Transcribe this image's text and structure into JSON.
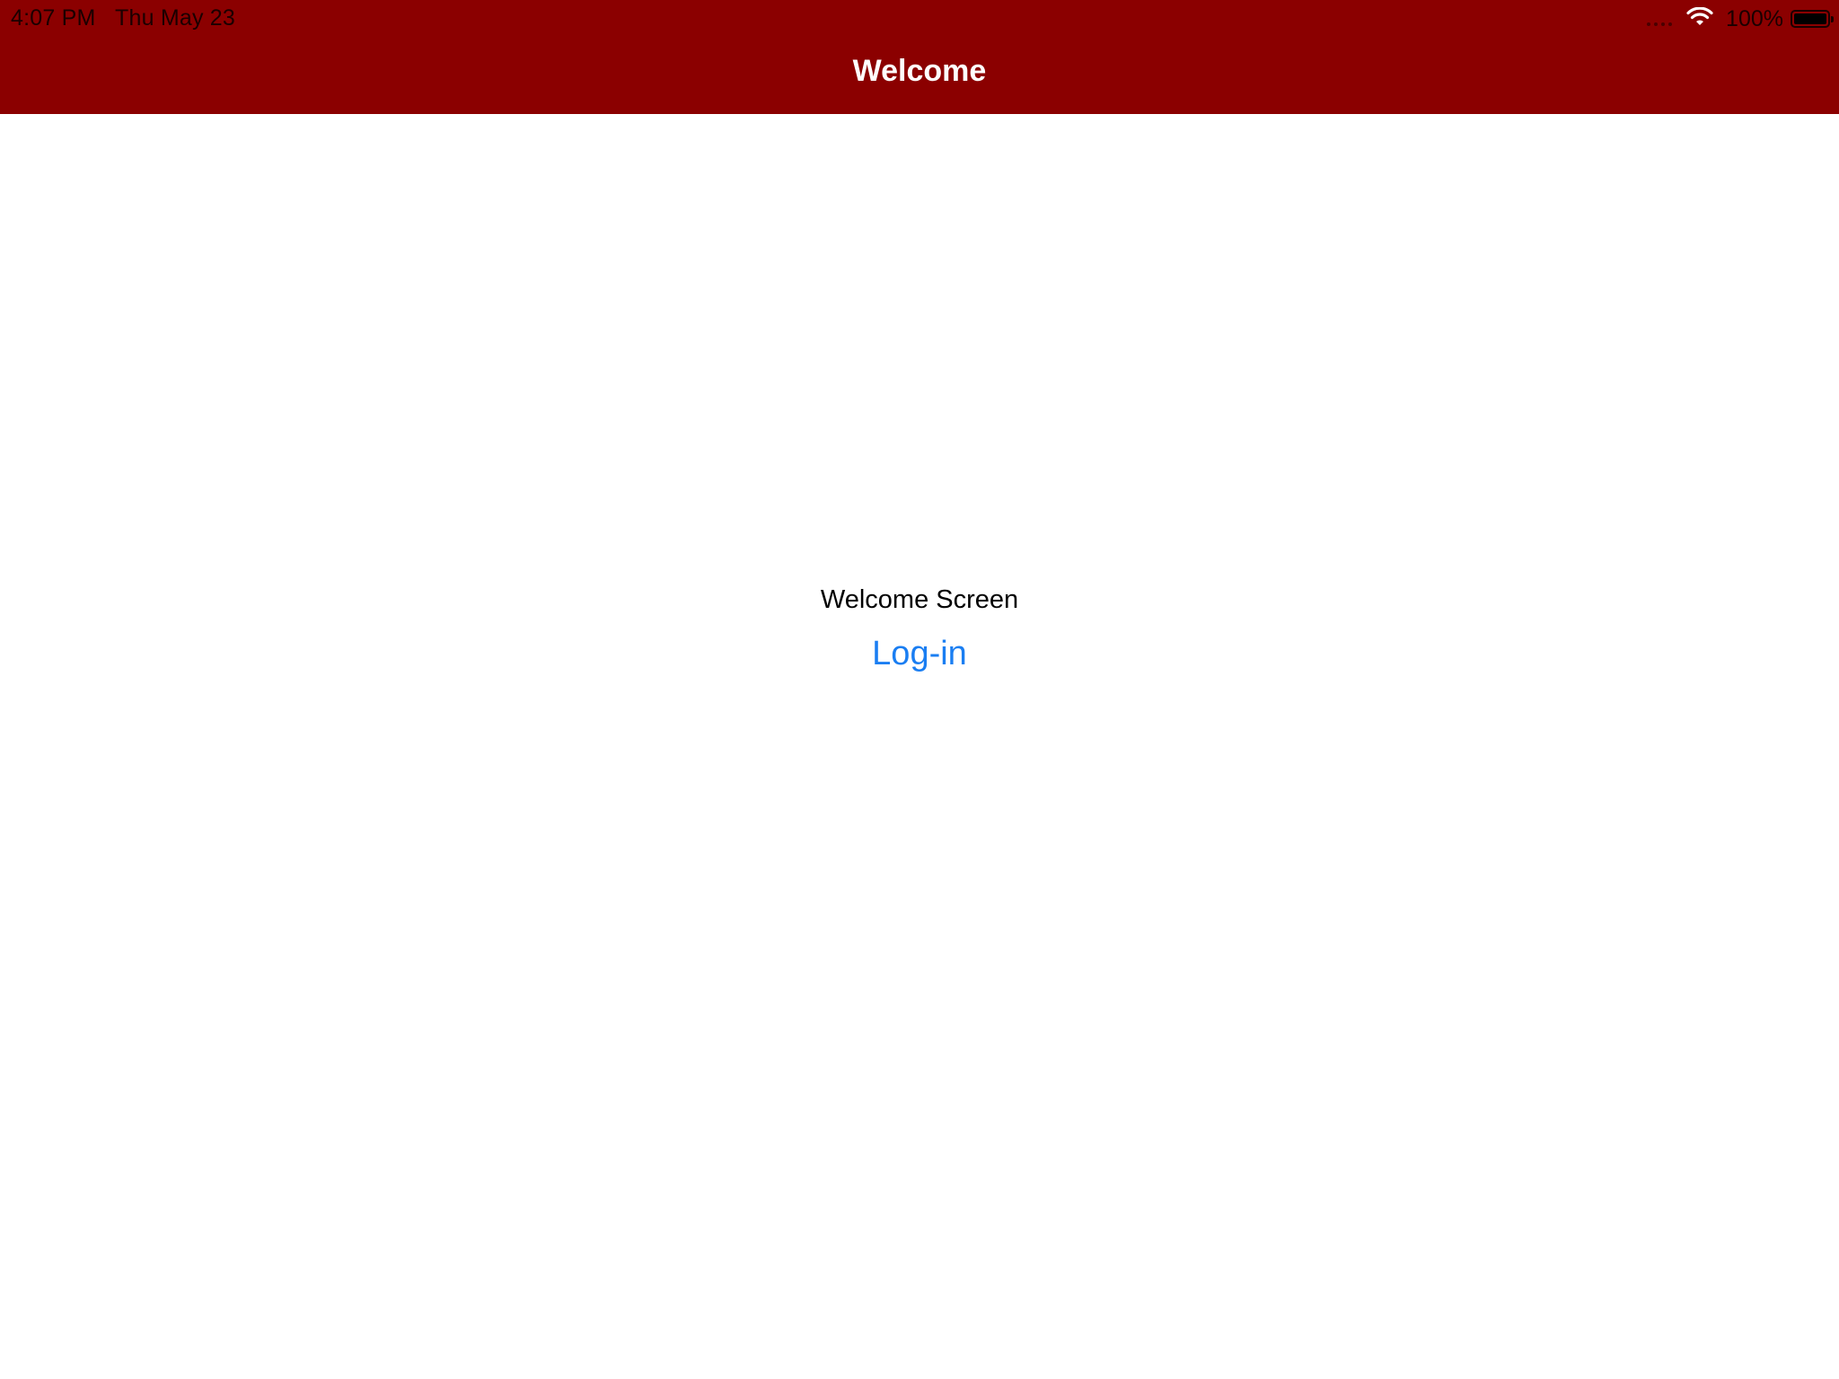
{
  "status_bar": {
    "time": "4:07 PM",
    "date": "Thu May 23",
    "battery_percent": "100%",
    "battery_level": 1.0,
    "icons": [
      "cellular-signal-icon",
      "wifi-icon",
      "battery-icon"
    ]
  },
  "nav_bar": {
    "title": "Welcome",
    "background_color": "#8b0000",
    "title_color": "#ffffff"
  },
  "main": {
    "welcome_label": "Welcome Screen",
    "login_button_label": "Log-in",
    "login_button_color": "#1a7ef2"
  }
}
